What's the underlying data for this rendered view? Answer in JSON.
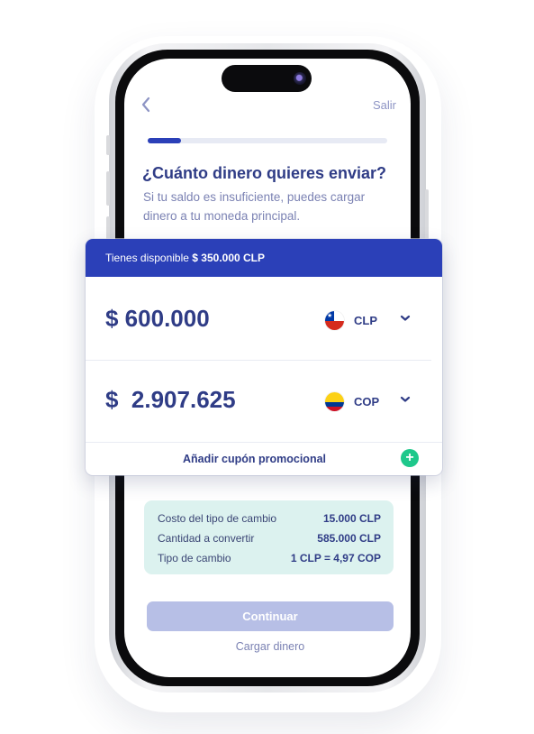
{
  "nav": {
    "back_icon": "chevron-left-icon",
    "exit_label": "Salir"
  },
  "progress": {
    "value_fraction": 0.14
  },
  "heading": {
    "title": "¿Cuánto dinero quieres enviar?",
    "subtitle": "Si tu saldo es insuficiente, puedes cargar dinero a tu moneda principal."
  },
  "balance": {
    "prefix": "Tienes disponible",
    "amount": "$ 350.000 CLP"
  },
  "send": {
    "amount": "$ 600.000",
    "currency": "CLP",
    "flag_icon": "chile-flag-icon"
  },
  "receive": {
    "amount": "$  2.907.625",
    "currency": "COP",
    "flag_icon": "colombia-flag-icon"
  },
  "coupon": {
    "label": "Añadir cupón promocional",
    "icon": "plus-circle-icon"
  },
  "summary": {
    "rows": [
      {
        "label": "Costo del tipo de cambio",
        "value": "15.000 CLP"
      },
      {
        "label": "Cantidad a convertir",
        "value": "585.000 CLP"
      },
      {
        "label": "Tipo de cambio",
        "value": "1 CLP = 4,97 COP"
      }
    ]
  },
  "actions": {
    "continue_label": "Continuar",
    "load_label": "Cargar dinero"
  },
  "colors": {
    "primary": "#2b40b8",
    "text_primary": "#2f3c86",
    "muted": "#7b82b3",
    "summary_bg": "#dcf2ef",
    "continue_disabled": "#b7bfe6",
    "accent_green": "#1ec88b"
  }
}
